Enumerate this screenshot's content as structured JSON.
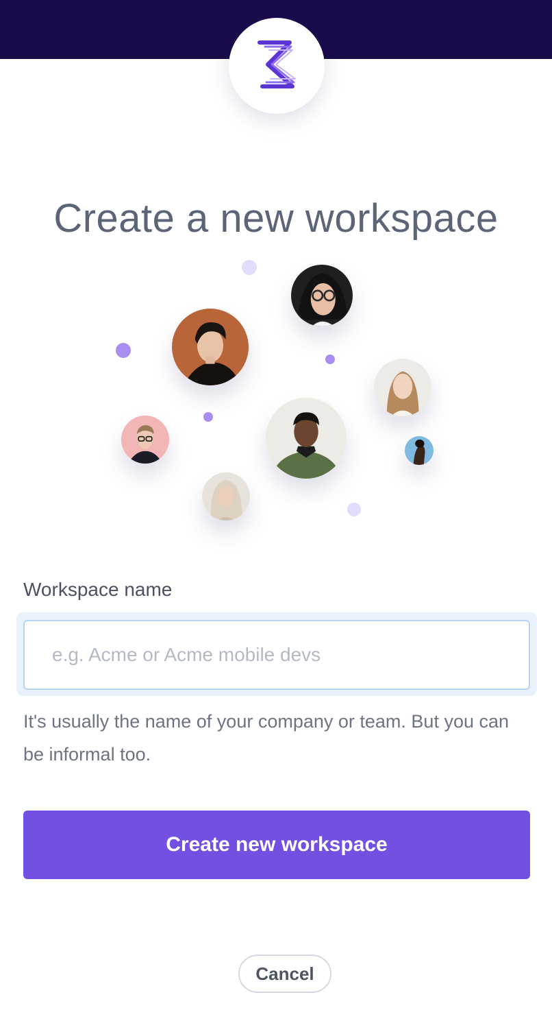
{
  "app": {
    "brand_icon": "s-logo-icon",
    "accent": "#7350e1",
    "header_bg": "#1a0b4a"
  },
  "title": "Create a new workspace",
  "illustration": {
    "avatars": [
      {
        "name": "avatar-man-dark-hair",
        "bg": "#b8653a"
      },
      {
        "name": "avatar-woman-glasses",
        "bg": "#1f1f1f"
      },
      {
        "name": "avatar-woman-braid",
        "bg": "#ecebe7"
      },
      {
        "name": "avatar-man-glasses",
        "bg": "#f2b6b6"
      },
      {
        "name": "avatar-man-green-sweater",
        "bg": "#ecebe6"
      },
      {
        "name": "avatar-woman-profile",
        "bg": "#7fbbe0"
      },
      {
        "name": "avatar-woman-blonde",
        "bg": "#e8e2dc"
      }
    ],
    "dot_colors": [
      "#a98df0",
      "#e3dbfb"
    ]
  },
  "form": {
    "label": "Workspace name",
    "placeholder": "e.g. Acme or Acme mobile devs",
    "value": "",
    "help": "It's usually the name of your company or team. But you can be informal too."
  },
  "actions": {
    "create_label": "Create new workspace",
    "cancel_label": "Cancel"
  }
}
